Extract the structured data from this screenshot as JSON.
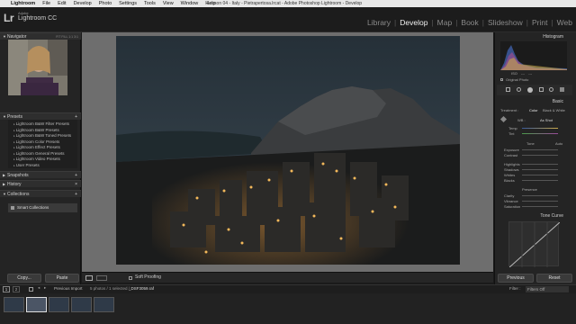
{
  "menubar": {
    "apple_icon": "apple-icon",
    "items": [
      "Lightroom",
      "File",
      "Edit",
      "Develop",
      "Photo",
      "Settings",
      "Tools",
      "View",
      "Window",
      "Help"
    ],
    "window_title": "Lesson 04 - Italy - Pietrapertosa.lrcat - Adobe Photoshop Lightroom - Develop"
  },
  "identity": {
    "logo": "Lr",
    "adobe": "Adobe",
    "product": "Lightroom CC"
  },
  "modules": [
    "Library",
    "Develop",
    "Map",
    "Book",
    "Slideshow",
    "Print",
    "Web"
  ],
  "active_module": "Develop",
  "left": {
    "navigator": {
      "title": "Navigator",
      "zoom": [
        "FIT",
        "FILL",
        "1:1",
        "3:1"
      ]
    },
    "presets": {
      "title": "Presets",
      "items": [
        "Lightroom B&W Filter Presets",
        "Lightroom B&W Presets",
        "Lightroom B&W Toned Presets",
        "Lightroom Color Presets",
        "Lightroom Effect Presets",
        "Lightroom General Presets",
        "Lightroom Video Presets",
        "User Presets"
      ]
    },
    "snapshots": "Snapshots",
    "history": "History",
    "collections": {
      "title": "Collections",
      "smart": "Smart Collections"
    },
    "copy_button": "Copy...",
    "paste_button": "Paste"
  },
  "toolbar": {
    "soft_proofing": "Soft Proofing"
  },
  "right": {
    "histogram": {
      "title": "Histogram",
      "readout": [
        "ISO",
        "---",
        "---"
      ],
      "original_photo": "Original Photo"
    },
    "basic": {
      "title": "Basic",
      "treatment_label": "Treatment :",
      "color": "Color",
      "bw": "Black & White",
      "wb_label": "WB :",
      "wb_value": "As Shot",
      "temp": "Temp",
      "tint": "Tint",
      "tone": "Tone",
      "auto": "Auto",
      "tone_rows": [
        "Exposure",
        "Contrast",
        "Highlights",
        "Shadows",
        "Whites",
        "Blacks"
      ],
      "presence": "Presence",
      "presence_rows": [
        "Clarity",
        "Vibrance",
        "Saturation"
      ]
    },
    "tone_curve": {
      "title": "Tone Curve"
    },
    "previous_button": "Previous",
    "reset_button": "Reset"
  },
  "filmbar": {
    "page_1": "1",
    "page_2": "2",
    "source": "Previous Import",
    "selection": "5 photos / 1 selected /",
    "filename": "_DSF3059.raf",
    "filter_label": "Filter :",
    "filter_value": "Filters Off"
  },
  "filmstrip": {
    "count": 5,
    "selected_index": 1
  }
}
